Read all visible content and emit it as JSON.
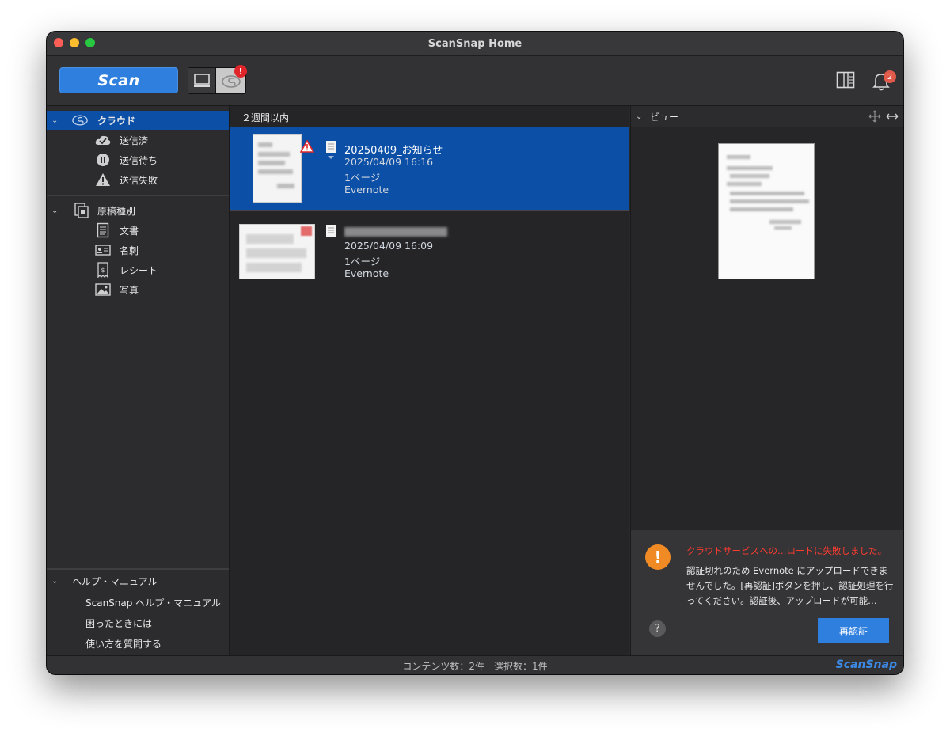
{
  "window": {
    "title": "ScanSnap Home"
  },
  "toolbar": {
    "scan_label": "Scan",
    "mode_badge": "!",
    "notification_count": "2"
  },
  "sidebar": {
    "cloud": {
      "label": "クラウド",
      "items": [
        {
          "label": "送信済",
          "icon": "check-cloud-icon"
        },
        {
          "label": "送信待ち",
          "icon": "pause-icon"
        },
        {
          "label": "送信失敗",
          "icon": "warning-icon"
        }
      ]
    },
    "doc_types": {
      "label": "原稿種別",
      "items": [
        {
          "label": "文書",
          "icon": "document-icon"
        },
        {
          "label": "名刺",
          "icon": "business-card-icon"
        },
        {
          "label": "レシート",
          "icon": "receipt-icon"
        },
        {
          "label": "写真",
          "icon": "photo-icon"
        }
      ]
    },
    "help": {
      "label": "ヘルプ・マニュアル",
      "items": [
        {
          "label": "ScanSnap ヘルプ・マニュアル"
        },
        {
          "label": "困ったときには"
        },
        {
          "label": "使い方を質問する"
        }
      ]
    }
  },
  "list": {
    "group_header": "２週間以内",
    "items": [
      {
        "title": "20250409_お知らせ",
        "datetime": "2025/04/09 16:16",
        "pages": "1ページ",
        "service": "Evernote",
        "selected": true,
        "error": true
      },
      {
        "title": "",
        "datetime": "2025/04/09 16:09",
        "pages": "1ページ",
        "service": "Evernote",
        "selected": false,
        "error": false
      }
    ]
  },
  "view": {
    "header": "ビュー",
    "error": {
      "title": "クラウドサービスへの…ロードに失敗しました。",
      "body": "認証切れのため Evernote にアップロードできませんでした。[再認証]ボタンを押し、認証処理を行ってください。認証後、アップロードが可能…",
      "help": "?",
      "button": "再認証"
    }
  },
  "status": {
    "text": "コンテンツ数：2件　選択数：1件",
    "brand": "ScanSnap"
  },
  "colors": {
    "accent": "#2f7fde",
    "selection": "#0b4fa6",
    "error_text": "#ff3b30",
    "warning": "#f08a24"
  }
}
